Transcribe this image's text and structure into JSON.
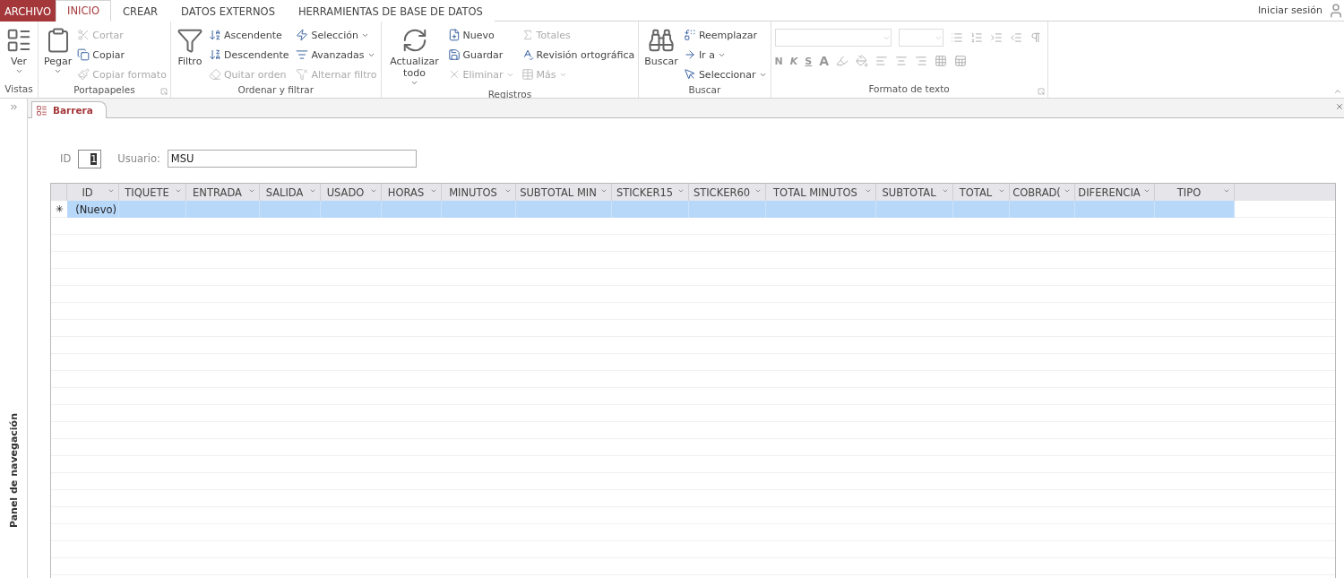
{
  "ribbon_tabs": [
    {
      "label": "ARCHIVO",
      "kind": "file",
      "selected": false
    },
    {
      "label": "INICIO",
      "kind": "tab",
      "selected": true
    },
    {
      "label": "CREAR",
      "kind": "tab",
      "selected": false
    },
    {
      "label": "DATOS EXTERNOS",
      "kind": "tab",
      "selected": false
    },
    {
      "label": "HERRAMIENTAS DE BASE DE DATOS",
      "kind": "tab",
      "selected": false
    }
  ],
  "sign_in": "Iniciar sesión",
  "groups": [
    {
      "title": "Vistas",
      "large": {
        "label": "Ver",
        "dropdown": true
      }
    },
    {
      "title": "Portapapeles",
      "launcher": true,
      "large": {
        "label": "Pegar",
        "dropdown": true
      },
      "items": [
        {
          "label": "Cortar",
          "disabled": true,
          "dropdown": false
        },
        {
          "label": "Copiar",
          "disabled": false,
          "dropdown": false
        },
        {
          "label": "Copiar formato",
          "disabled": true,
          "dropdown": false
        }
      ]
    },
    {
      "title": "Ordenar y filtrar",
      "large": {
        "label": "Filtro",
        "dropdown": false
      },
      "items": [
        {
          "label": "Ascendente",
          "disabled": false,
          "dropdown": false
        },
        {
          "label": "Descendente",
          "disabled": false,
          "dropdown": false
        },
        {
          "label": "Quitar orden",
          "disabled": true,
          "dropdown": false
        },
        {
          "label": "Selección",
          "disabled": false,
          "dropdown": true
        },
        {
          "label": "Avanzadas",
          "disabled": false,
          "dropdown": true
        },
        {
          "label": "Alternar filtro",
          "disabled": true,
          "dropdown": false
        }
      ]
    },
    {
      "title": "Registros",
      "large": {
        "label": "Actualizar todo",
        "dropdown": true
      },
      "items": [
        {
          "label": "Nuevo",
          "disabled": false,
          "dropdown": false
        },
        {
          "label": "Guardar",
          "disabled": false,
          "dropdown": false
        },
        {
          "label": "Eliminar",
          "disabled": true,
          "dropdown": true
        },
        {
          "label": "Totales",
          "disabled": true,
          "dropdown": false
        },
        {
          "label": "Revisión ortográfica",
          "disabled": false,
          "dropdown": false
        },
        {
          "label": "Más",
          "disabled": true,
          "dropdown": true
        }
      ]
    },
    {
      "title": "Buscar",
      "large": {
        "label": "Buscar",
        "dropdown": false
      },
      "items": [
        {
          "label": "Reemplazar",
          "disabled": false,
          "dropdown": false
        },
        {
          "label": "Ir a",
          "disabled": false,
          "dropdown": true
        },
        {
          "label": "Seleccionar",
          "disabled": false,
          "dropdown": true
        }
      ]
    },
    {
      "title": "Formato de texto",
      "launcher": true,
      "format_letters": [
        "N",
        "K",
        "S",
        "A"
      ]
    }
  ],
  "document_tab": {
    "label": "Barrera"
  },
  "nav_pane": {
    "label": "Panel de navegación"
  },
  "form": {
    "id_label": "ID",
    "id_value": "1",
    "user_label": "Usuario:",
    "user_value": "MSU"
  },
  "table": {
    "columns": [
      "ID",
      "TIQUETE",
      "ENTRADA",
      "SALIDA",
      "USADO",
      "HORAS",
      "MINUTOS",
      "SUBTOTAL MIN",
      "STICKER15",
      "STICKER60",
      "TOTAL MINUTOS",
      "SUBTOTAL",
      "TOTAL",
      "COBRAD(",
      "DIFERENCIA",
      "TIPO"
    ],
    "new_row": {
      "marker": "✳",
      "id": "(Nuevo)",
      "selected": true
    }
  }
}
